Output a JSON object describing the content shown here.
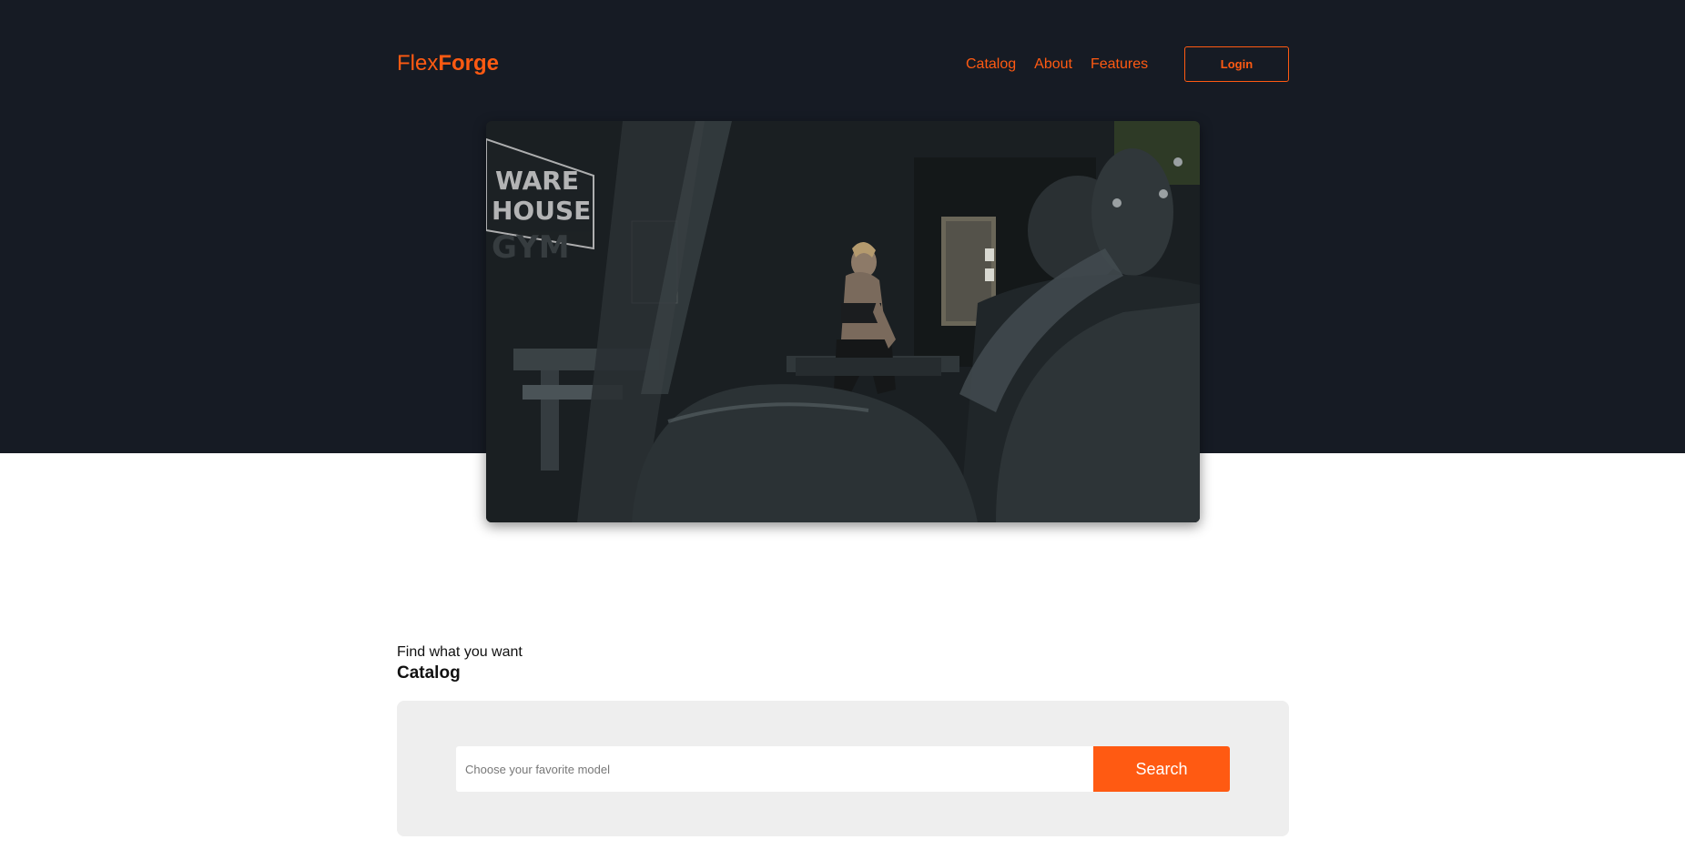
{
  "brand": {
    "name_light": "Flex",
    "name_bold": "Forge",
    "accent_color": "#ff5a12"
  },
  "nav": {
    "items": [
      {
        "label": "Catalog"
      },
      {
        "label": "About"
      },
      {
        "label": "Features"
      }
    ]
  },
  "header": {
    "login_label": "Login"
  },
  "hero": {
    "video_signage_left": "WARE HOUSE GYM"
  },
  "catalog": {
    "subtitle": "Find what you want",
    "title": "Catalog",
    "search_placeholder": "Choose your favorite model",
    "search_label": "Search"
  },
  "colors": {
    "hero_background": "#161b24",
    "panel_background": "#eeeeee"
  }
}
